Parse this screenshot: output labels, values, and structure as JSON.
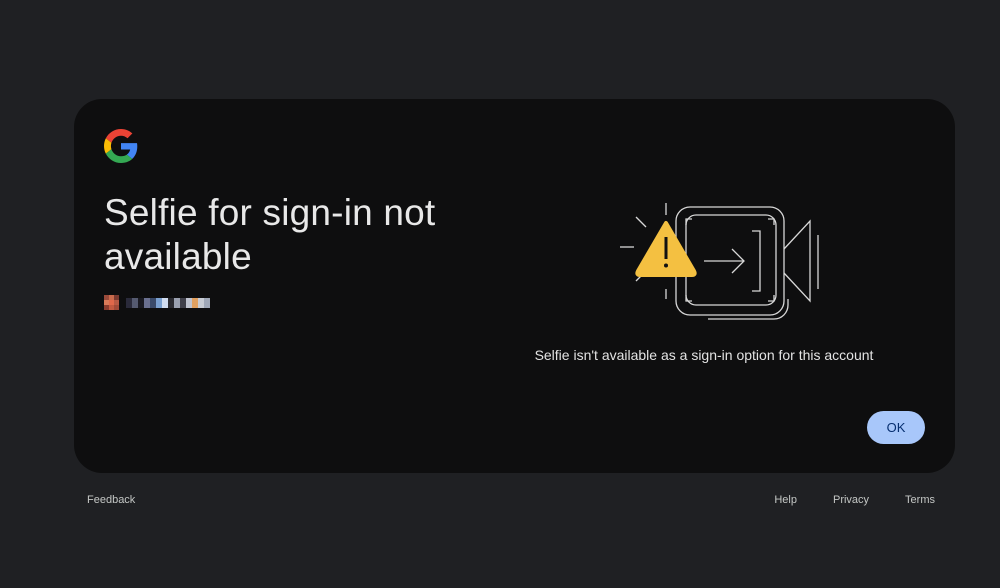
{
  "dialog": {
    "title": "Selfie for sign-in not available",
    "message": "Selfie isn't available as a sign-in option for this account",
    "ok_label": "OK"
  },
  "account": {
    "email_obscured": true
  },
  "icons": {
    "logo": "google-g-icon",
    "illustration": "warning-video-camera-icon"
  },
  "footer": {
    "feedback": "Feedback",
    "help": "Help",
    "privacy": "Privacy",
    "terms": "Terms"
  },
  "colors": {
    "background": "#1f2023",
    "card": "#0e0e0f",
    "accent_button": "#a8c7fa",
    "warning": "#f4c041"
  }
}
